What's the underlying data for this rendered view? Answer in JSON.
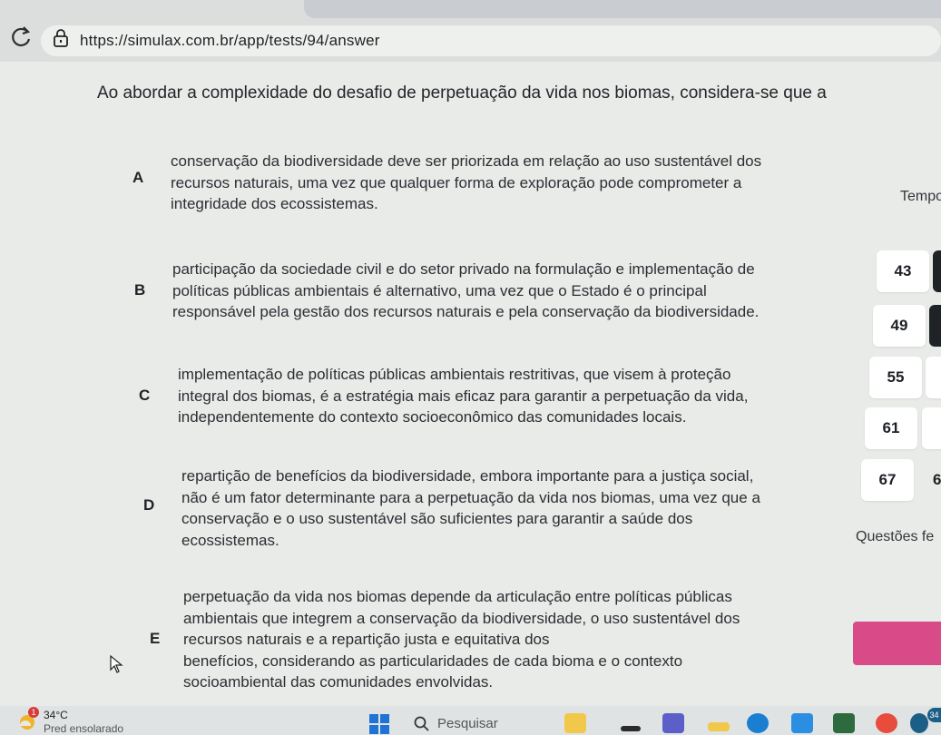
{
  "browser": {
    "url": "https://simulax.com.br/app/tests/94/answer"
  },
  "question": {
    "text": "Ao abordar a complexidade do desafio de perpetuação da vida nos biomas, considera-se que a"
  },
  "options": [
    {
      "letter": "A",
      "lines": [
        "conservação da biodiversidade deve ser priorizada em relação ao uso sustentável dos",
        "recursos naturais, uma vez que qualquer forma de exploração pode comprometer a",
        "integridade dos ecossistemas."
      ]
    },
    {
      "letter": "B",
      "lines": [
        "participação da sociedade civil e do setor privado na formulação e implementação de",
        "políticas públicas ambientais é alternativo, uma vez que o Estado é o principal",
        "responsável pela gestão dos recursos naturais e pela conservação da biodiversidade."
      ]
    },
    {
      "letter": "C",
      "lines": [
        "implementação de políticas públicas ambientais restritivas, que visem à proteção",
        "integral dos biomas, é a estratégia mais eficaz para garantir a perpetuação da vida,",
        "independentemente do contexto socioeconômico das comunidades locais."
      ]
    },
    {
      "letter": "D",
      "lines": [
        "repartição de benefícios da biodiversidade, embora importante para a justiça social,",
        "não é um fator determinante para a perpetuação da vida nos biomas, uma vez que a",
        "conservação e o uso sustentável são suficientes para garantir a saúde dos",
        "ecossistemas."
      ]
    },
    {
      "letter": "E",
      "lines": [
        "perpetuação da vida nos biomas depende da articulação entre políticas públicas",
        "ambientais que integrem a conservação da biodiversidade, o uso sustentável dos",
        "recursos naturais e a repartição justa e equitativa dos",
        "benefícios, considerando as particularidades de cada bioma e o contexto",
        "socioambiental das comunidades envolvidas."
      ]
    }
  ],
  "sidebar": {
    "tempo_label": "Tempo",
    "question_numbers": [
      "43",
      "49",
      "55",
      "61",
      "67"
    ],
    "questoes_label": "Questões fe"
  },
  "taskbar": {
    "weather_badge": "1",
    "temperature": "34°C",
    "weather_desc": "Pred ensolarado",
    "search_label": "Pesquisar",
    "badge": "34"
  },
  "colors": {
    "accent_pink": "#d94b88",
    "page_bg": "#e9ebe8"
  }
}
